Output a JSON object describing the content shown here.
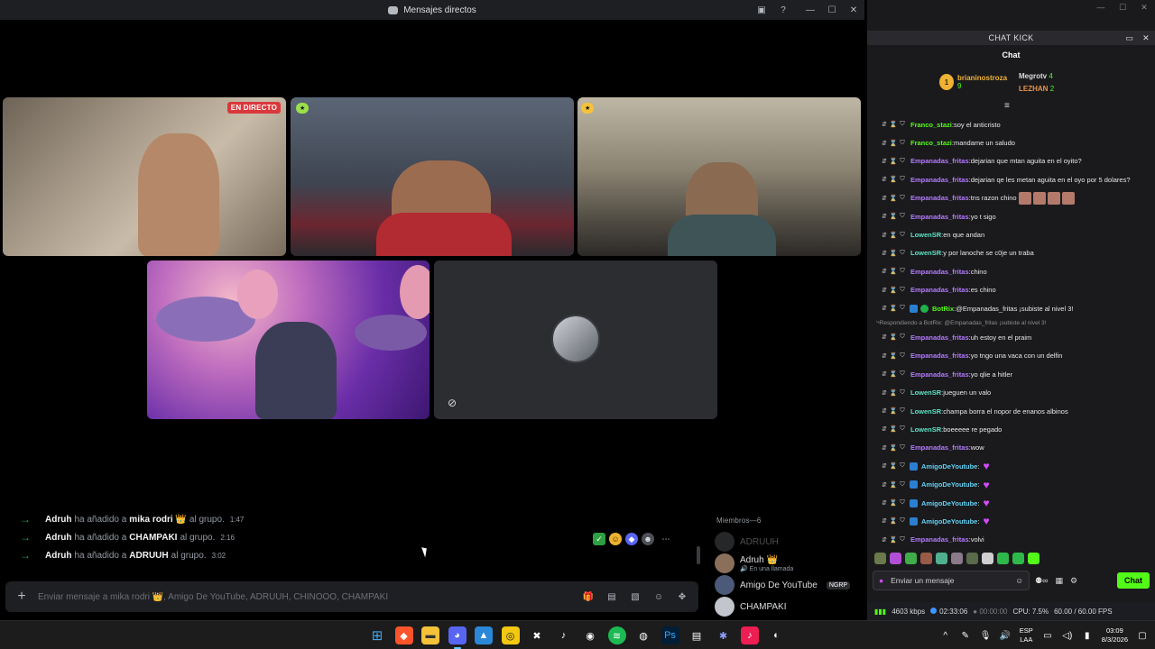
{
  "discord": {
    "window_title": "Mensajes directos",
    "live_badge": "EN DIRECTO",
    "system_messages": [
      {
        "actor": "Adruh",
        "verb": "ha añadido a",
        "target": "mika rodri 👑",
        "suffix": "al grupo.",
        "time": "1:47"
      },
      {
        "actor": "Adruh",
        "verb": "ha añadido a",
        "target": "CHAMPAKI",
        "suffix": "al grupo.",
        "time": "2:16"
      },
      {
        "actor": "Adruh",
        "verb": "ha añadido a",
        "target": "ADRUUH",
        "suffix": "al grupo.",
        "time": "3:02"
      }
    ],
    "input_placeholder": "Enviar mensaje a mika rodri 👑, Amigo De YouTube, ADRUUH, CHINOOO, CHAMPAKI",
    "members": {
      "header": "Miembros—6",
      "list": [
        {
          "name": "ADRUUH",
          "sub": ""
        },
        {
          "name": "Adruh 👑",
          "sub": "🔊 En una llamada"
        },
        {
          "name": "Amigo De YouTube",
          "sub": "",
          "badge": "NGRP"
        },
        {
          "name": "CHAMPAKI",
          "sub": ""
        }
      ]
    }
  },
  "kick": {
    "header": "CHAT KICK",
    "chat_title": "Chat",
    "leaderboard": {
      "first": {
        "rank": "1",
        "name": "brianinostroza",
        "count": "9"
      },
      "second": {
        "name": "Megrotv",
        "count": "4"
      },
      "third": {
        "name": "LEZHAN",
        "count": "2"
      }
    },
    "messages": [
      {
        "user": "Franco_stazi",
        "color": "green",
        "text": "soy el anticristo"
      },
      {
        "user": "Franco_stazi",
        "color": "green",
        "text": "mandame un saludo"
      },
      {
        "user": "Empanadas_fritas",
        "color": "purple",
        "text": "dejarian que mtan aguita en el oyito?"
      },
      {
        "user": "Empanadas_fritas",
        "color": "purple",
        "text": "dejarian qe les metan aguita en el oyo por 5 dolares?"
      },
      {
        "user": "Empanadas_fritas",
        "color": "purple",
        "text": "tns razon chino"
      },
      {
        "user": "Empanadas_fritas",
        "color": "purple",
        "text": "yo t sigo"
      },
      {
        "user": "LowenSR",
        "color": "teal",
        "text": "en que andan"
      },
      {
        "user": "LowenSR",
        "color": "teal",
        "text": "y por lanoche se c0je un traba"
      },
      {
        "user": "Empanadas_fritas",
        "color": "purple",
        "text": "chino"
      },
      {
        "user": "Empanadas_fritas",
        "color": "purple",
        "text": "es chino"
      },
      {
        "user": "BotRix",
        "color": "green",
        "text": "@Empanadas_fritas ¡subiste al nivel 3!"
      },
      {
        "reply": "Respondiendo a BotRix: @Empanadas_fritas ¡subiste al nivel 3!"
      },
      {
        "user": "Empanadas_fritas",
        "color": "purple",
        "text": "uh estoy en el praim"
      },
      {
        "user": "Empanadas_fritas",
        "color": "purple",
        "text": "yo tngo una vaca con un delfin"
      },
      {
        "user": "Empanadas_fritas",
        "color": "purple",
        "text": "yo qlie a hitler"
      },
      {
        "user": "LowenSR",
        "color": "teal",
        "text": "jueguen un valo"
      },
      {
        "user": "LowenSR",
        "color": "teal",
        "text": "champa borra el nopor de enanos albinos"
      },
      {
        "user": "LowenSR",
        "color": "teal",
        "text": "boeeeee re pegado"
      },
      {
        "user": "Empanadas_fritas",
        "color": "purple",
        "text": "wow"
      },
      {
        "user": "AmigoDeYoutube",
        "color": "sky",
        "text": ""
      },
      {
        "user": "AmigoDeYoutube",
        "color": "sky",
        "text": ""
      },
      {
        "user": "AmigoDeYoutube",
        "color": "sky",
        "text": ""
      },
      {
        "user": "AmigoDeYoutube",
        "color": "sky",
        "text": ""
      },
      {
        "user": "Empanadas_fritas",
        "color": "purple",
        "text": "volvi"
      }
    ],
    "input_placeholder": "Enviar un mensaje",
    "chat_button": "Chat"
  },
  "obs_status": {
    "bitrate": "4603 kbps",
    "live_time": "02:33:06",
    "rec_time": "00:00:00",
    "cpu": "CPU: 7.5%",
    "fps": "60.00 / 60.00 FPS"
  },
  "taskbar": {
    "lang_line1": "ESP",
    "lang_line2": "LAA",
    "time": "03:09",
    "date": "8/3/2026"
  },
  "colors": {
    "kick_green": "#53fc18",
    "discord_dark": "#1e1f22",
    "live_red": "#da373c"
  }
}
